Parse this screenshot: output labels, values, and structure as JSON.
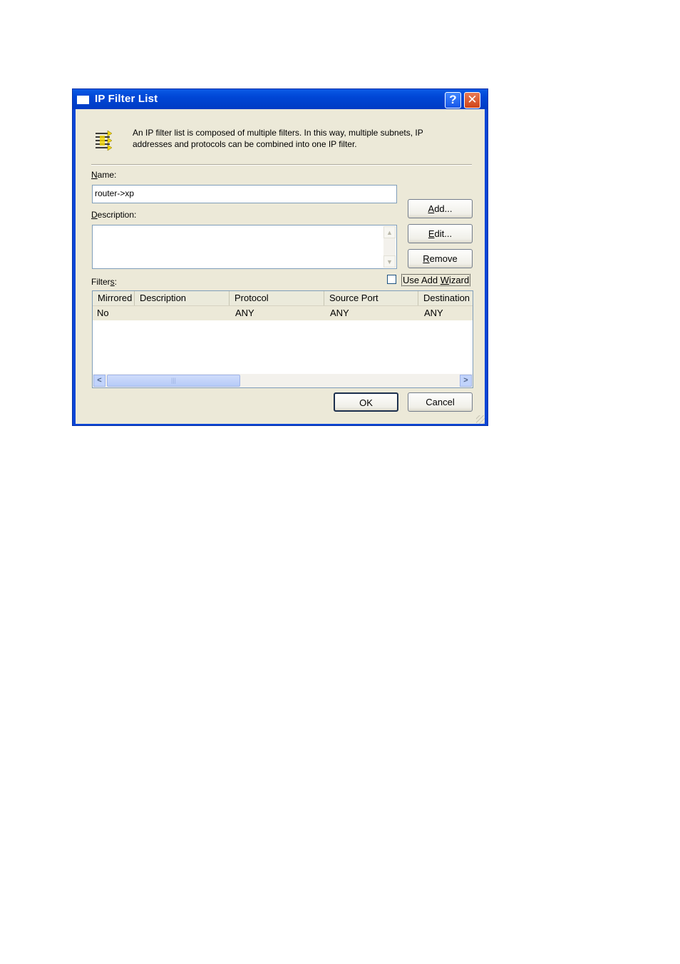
{
  "window": {
    "title": "IP Filter List",
    "help_glyph": "?",
    "close_glyph": "✕"
  },
  "intro_text": "An IP filter list is composed of multiple filters. In this way, multiple subnets, IP addresses and protocols can be combined into one IP filter.",
  "name": {
    "label_prefix": "N",
    "label_rest": "ame:",
    "value": "router->xp"
  },
  "description": {
    "label_prefix": "D",
    "label_rest": "escription:",
    "value": ""
  },
  "buttons": {
    "add": {
      "prefix": "A",
      "rest": "dd..."
    },
    "edit": {
      "prefix": "E",
      "rest": "dit..."
    },
    "remove": {
      "prefix": "R",
      "rest": "emove"
    },
    "ok": "OK",
    "cancel": "Cancel"
  },
  "wizard": {
    "label_a": "Use Add ",
    "label_u": "W",
    "label_b": "izard",
    "checked": false
  },
  "filters": {
    "label_a": "Filter",
    "label_u": "s",
    "label_b": ":",
    "columns": [
      "Mirrored",
      "Description",
      "Protocol",
      "Source Port",
      "Destination"
    ],
    "rows": [
      {
        "mirrored": "No",
        "description": "",
        "protocol": "ANY",
        "source_port": "ANY",
        "destination": "ANY"
      }
    ]
  },
  "colors": {
    "title_bar": "#0046d5",
    "dialog_face": "#ece9d8",
    "selected_row": "#ece9d8"
  }
}
